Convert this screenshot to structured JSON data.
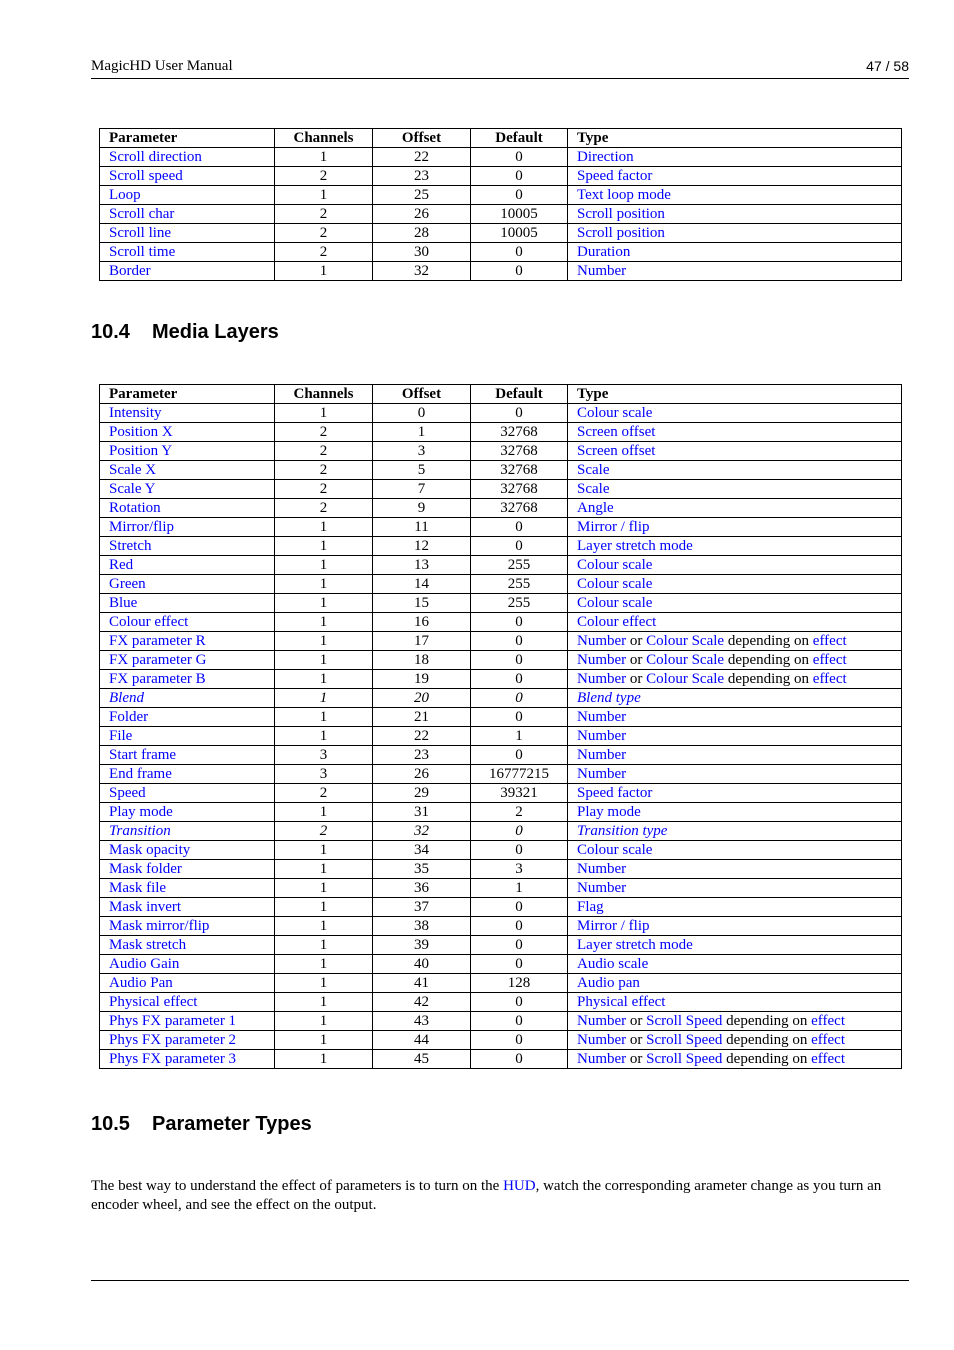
{
  "header": {
    "title": "MagicHD User Manual",
    "page": "47 / 58"
  },
  "colors": {
    "link": "#0000ff",
    "text": "#000000"
  },
  "columns": [
    "Parameter",
    "Channels",
    "Offset",
    "Default",
    "Type"
  ],
  "table1": {
    "rows": [
      {
        "param": "Scroll direction",
        "channels": "1",
        "offset": "22",
        "default": "0",
        "type": [
          {
            "t": "Direction",
            "link": true
          }
        ]
      },
      {
        "param": "Scroll speed",
        "channels": "2",
        "offset": "23",
        "default": "0",
        "type": [
          {
            "t": "Speed factor",
            "link": true
          }
        ]
      },
      {
        "param": "Loop",
        "channels": "1",
        "offset": "25",
        "default": "0",
        "type": [
          {
            "t": "Text loop mode",
            "link": true
          }
        ]
      },
      {
        "param": "Scroll char",
        "channels": "2",
        "offset": "26",
        "default": "10005",
        "type": [
          {
            "t": "Scroll position",
            "link": true
          }
        ]
      },
      {
        "param": "Scroll line",
        "channels": "2",
        "offset": "28",
        "default": "10005",
        "type": [
          {
            "t": "Scroll position",
            "link": true
          }
        ]
      },
      {
        "param": "Scroll time",
        "channels": "2",
        "offset": "30",
        "default": "0",
        "type": [
          {
            "t": "Duration",
            "link": true
          }
        ]
      },
      {
        "param": "Border",
        "channels": "1",
        "offset": "32",
        "default": "0",
        "type": [
          {
            "t": "Number",
            "link": true
          }
        ]
      }
    ]
  },
  "section_media": {
    "number": "10.4",
    "title": "Media Layers"
  },
  "table2": {
    "rows": [
      {
        "param": "Intensity",
        "channels": "1",
        "offset": "0",
        "default": "0",
        "type": [
          {
            "t": "Colour scale",
            "link": true
          }
        ]
      },
      {
        "param": "Position X",
        "channels": "2",
        "offset": "1",
        "default": "32768",
        "type": [
          {
            "t": "Screen offset",
            "link": true
          }
        ]
      },
      {
        "param": "Position Y",
        "channels": "2",
        "offset": "3",
        "default": "32768",
        "type": [
          {
            "t": "Screen offset",
            "link": true
          }
        ]
      },
      {
        "param": "Scale X",
        "channels": "2",
        "offset": "5",
        "default": "32768",
        "type": [
          {
            "t": "Scale",
            "link": true
          }
        ]
      },
      {
        "param": "Scale Y",
        "channels": "2",
        "offset": "7",
        "default": "32768",
        "type": [
          {
            "t": "Scale",
            "link": true
          }
        ]
      },
      {
        "param": "Rotation",
        "channels": "2",
        "offset": "9",
        "default": "32768",
        "type": [
          {
            "t": "Angle",
            "link": true
          }
        ]
      },
      {
        "param": "Mirror/flip",
        "channels": "1",
        "offset": "11",
        "default": "0",
        "type": [
          {
            "t": "Mirror / flip",
            "link": true
          }
        ]
      },
      {
        "param": "Stretch",
        "channels": "1",
        "offset": "12",
        "default": "0",
        "type": [
          {
            "t": "Layer stretch mode",
            "link": true
          }
        ]
      },
      {
        "param": "Red",
        "channels": "1",
        "offset": "13",
        "default": "255",
        "type": [
          {
            "t": "Colour scale",
            "link": true
          }
        ]
      },
      {
        "param": "Green",
        "channels": "1",
        "offset": "14",
        "default": "255",
        "type": [
          {
            "t": "Colour scale",
            "link": true
          }
        ]
      },
      {
        "param": "Blue",
        "channels": "1",
        "offset": "15",
        "default": "255",
        "type": [
          {
            "t": "Colour scale",
            "link": true
          }
        ]
      },
      {
        "param": "Colour effect",
        "channels": "1",
        "offset": "16",
        "default": "0",
        "type": [
          {
            "t": "Colour effect",
            "link": true
          }
        ]
      },
      {
        "param": "FX parameter R",
        "channels": "1",
        "offset": "17",
        "default": "0",
        "type": [
          {
            "t": "Number",
            "link": true
          },
          {
            "t": " or ",
            "link": false
          },
          {
            "t": "Colour Scale",
            "link": true
          },
          {
            "t": " depending on ",
            "link": false
          },
          {
            "t": "effect",
            "link": true
          }
        ]
      },
      {
        "param": "FX parameter G",
        "channels": "1",
        "offset": "18",
        "default": "0",
        "type": [
          {
            "t": "Number",
            "link": true
          },
          {
            "t": " or ",
            "link": false
          },
          {
            "t": "Colour Scale",
            "link": true
          },
          {
            "t": " depending on ",
            "link": false
          },
          {
            "t": "effect",
            "link": true
          }
        ]
      },
      {
        "param": "FX parameter B",
        "channels": "1",
        "offset": "19",
        "default": "0",
        "type": [
          {
            "t": "Number",
            "link": true
          },
          {
            "t": " or ",
            "link": false
          },
          {
            "t": "Colour Scale",
            "link": true
          },
          {
            "t": " depending on ",
            "link": false
          },
          {
            "t": "effect",
            "link": true
          }
        ]
      },
      {
        "param": "Blend",
        "channels": "1",
        "offset": "20",
        "default": "0",
        "italic": true,
        "type": [
          {
            "t": "Blend type",
            "link": true
          }
        ]
      },
      {
        "param": "Folder",
        "channels": "1",
        "offset": "21",
        "default": "0",
        "type": [
          {
            "t": "Number",
            "link": true
          }
        ]
      },
      {
        "param": "File",
        "channels": "1",
        "offset": "22",
        "default": "1",
        "type": [
          {
            "t": "Number",
            "link": true
          }
        ]
      },
      {
        "param": "Start frame",
        "channels": "3",
        "offset": "23",
        "default": "0",
        "type": [
          {
            "t": "Number",
            "link": true
          }
        ]
      },
      {
        "param": "End frame",
        "channels": "3",
        "offset": "26",
        "default": "16777215",
        "type": [
          {
            "t": "Number",
            "link": true
          }
        ]
      },
      {
        "param": "Speed",
        "channels": "2",
        "offset": "29",
        "default": "39321",
        "type": [
          {
            "t": "Speed factor",
            "link": true
          }
        ]
      },
      {
        "param": "Play mode",
        "channels": "1",
        "offset": "31",
        "default": "2",
        "type": [
          {
            "t": "Play mode",
            "link": true
          }
        ]
      },
      {
        "param": "Transition",
        "channels": "2",
        "offset": "32",
        "default": "0",
        "italic": true,
        "type": [
          {
            "t": "Transition type",
            "link": true
          }
        ]
      },
      {
        "param": "Mask opacity",
        "channels": "1",
        "offset": "34",
        "default": "0",
        "type": [
          {
            "t": "Colour scale",
            "link": true
          }
        ]
      },
      {
        "param": "Mask folder",
        "channels": "1",
        "offset": "35",
        "default": "3",
        "type": [
          {
            "t": "Number",
            "link": true
          }
        ]
      },
      {
        "param": "Mask file",
        "channels": "1",
        "offset": "36",
        "default": "1",
        "type": [
          {
            "t": "Number",
            "link": true
          }
        ]
      },
      {
        "param": "Mask invert",
        "channels": "1",
        "offset": "37",
        "default": "0",
        "type": [
          {
            "t": "Flag",
            "link": true
          }
        ]
      },
      {
        "param": "Mask mirror/flip",
        "channels": "1",
        "offset": "38",
        "default": "0",
        "type": [
          {
            "t": "Mirror / flip",
            "link": true
          }
        ]
      },
      {
        "param": "Mask stretch",
        "channels": "1",
        "offset": "39",
        "default": "0",
        "type": [
          {
            "t": "Layer stretch mode",
            "link": true
          }
        ]
      },
      {
        "param": "Audio Gain",
        "channels": "1",
        "offset": "40",
        "default": "0",
        "type": [
          {
            "t": "Audio scale",
            "link": true
          }
        ]
      },
      {
        "param": "Audio Pan",
        "channels": "1",
        "offset": "41",
        "default": "128",
        "type": [
          {
            "t": "Audio pan",
            "link": true
          }
        ]
      },
      {
        "param": "Physical effect",
        "channels": "1",
        "offset": "42",
        "default": "0",
        "type": [
          {
            "t": "Physical effect",
            "link": true
          }
        ]
      },
      {
        "param": "Phys FX parameter 1",
        "channels": "1",
        "offset": "43",
        "default": "0",
        "type": [
          {
            "t": "Number",
            "link": true
          },
          {
            "t": " or ",
            "link": false
          },
          {
            "t": "Scroll Speed",
            "link": true
          },
          {
            "t": " depending on ",
            "link": false
          },
          {
            "t": "effect",
            "link": true
          }
        ]
      },
      {
        "param": "Phys FX parameter 2",
        "channels": "1",
        "offset": "44",
        "default": "0",
        "type": [
          {
            "t": "Number",
            "link": true
          },
          {
            "t": " or ",
            "link": false
          },
          {
            "t": "Scroll Speed",
            "link": true
          },
          {
            "t": " depending on ",
            "link": false
          },
          {
            "t": "effect",
            "link": true
          }
        ]
      },
      {
        "param": "Phys FX parameter 3",
        "channels": "1",
        "offset": "45",
        "default": "0",
        "type": [
          {
            "t": "Number",
            "link": true
          },
          {
            "t": " or ",
            "link": false
          },
          {
            "t": "Scroll Speed",
            "link": true
          },
          {
            "t": " depending on ",
            "link": false
          },
          {
            "t": "effect",
            "link": true
          }
        ]
      }
    ]
  },
  "section_types": {
    "number": "10.5",
    "title": "Parameter Types"
  },
  "paragraph": {
    "before": "The best way to understand the effect of parameters is to turn on the ",
    "link": "HUD",
    "after": ", watch the corresponding arameter change as you turn an encoder wheel, and see the effect on the output."
  }
}
